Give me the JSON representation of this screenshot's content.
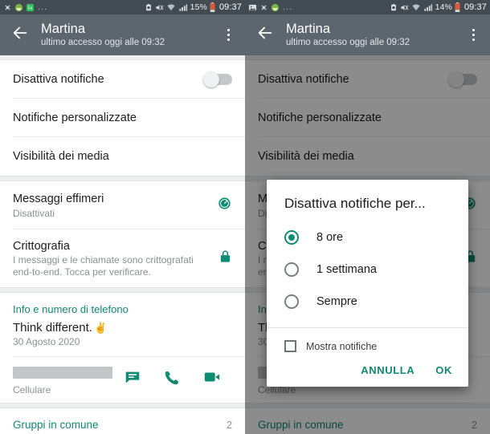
{
  "screens": [
    {
      "id": "left",
      "statusbar": {
        "left_icons": [
          "bluetooth-off-icon",
          "app-icon-green",
          "app-icon-5a"
        ],
        "overflow": "...",
        "right_icons": [
          "alarm-icon",
          "mute-icon",
          "wifi-icon",
          "signal-icon"
        ],
        "battery_percent": "15%",
        "battery_icon": "battery-icon",
        "time": "09:37"
      },
      "toolbar": {
        "back_icon": "back-arrow-icon",
        "title": "Martina",
        "subtitle": "ultimo accesso oggi alle 09:32",
        "menu_icon": "overflow-menu-icon"
      },
      "list": [
        {
          "title": "Disattiva notifiche",
          "control": "toggle-off"
        },
        {
          "title": "Notifiche personalizzate"
        },
        {
          "title": "Visibilità dei media"
        },
        {
          "title": "Messaggi effimeri",
          "subtitle": "Disattivati",
          "icon": "timer-icon"
        },
        {
          "title": "Crittografia",
          "subtitle": "I messaggi e le chiamate sono crittografati end-to-end. Tocca per verificare.",
          "icon": "lock-icon"
        }
      ],
      "info": {
        "section_label": "Info e numero di telefono",
        "bio": "Think different.",
        "bio_emoji": "✌️",
        "bio_date": "30 Agosto 2020",
        "number_label": "Cellulare",
        "number_value": "",
        "actions": [
          "message-icon",
          "call-icon",
          "video-call-icon"
        ]
      },
      "groups": {
        "label": "Gruppi in comune",
        "count": "2"
      },
      "dialog": null
    },
    {
      "id": "right",
      "statusbar": {
        "left_icons": [
          "image-icon",
          "bluetooth-off-icon",
          "app-icon-green"
        ],
        "overflow": "...",
        "right_icons": [
          "alarm-icon",
          "mute-icon",
          "wifi-icon",
          "signal-icon"
        ],
        "battery_percent": "14%",
        "battery_icon": "battery-icon",
        "time": "09:37"
      },
      "toolbar": {
        "back_icon": "back-arrow-icon",
        "title": "Martina",
        "subtitle": "ultimo accesso oggi alle 09:32",
        "menu_icon": "overflow-menu-icon"
      },
      "list": [
        {
          "title": "Disattiva notifiche",
          "control": "toggle-off"
        },
        {
          "title": "Notifiche personalizzate"
        },
        {
          "title": "Visibilità dei media"
        },
        {
          "title": "Messaggi effimeri",
          "subtitle": "Disattivati",
          "icon": "timer-icon"
        },
        {
          "title": "Crittografia",
          "subtitle": "I messaggi e le chiamate sono crittografati end-to-end. Tocca per verificare.",
          "icon": "lock-icon"
        }
      ],
      "info": {
        "section_label": "Info e numero di telefono",
        "bio": "Think different.",
        "bio_emoji": "✌️",
        "bio_date": "30 Agosto 2020",
        "number_label": "Cellulare",
        "number_value": "",
        "actions": [
          "message-icon",
          "call-icon",
          "video-call-icon"
        ]
      },
      "groups": {
        "label": "Gruppi in comune",
        "count": "2"
      },
      "dialog": {
        "title": "Disattiva notifiche per...",
        "options": [
          {
            "label": "8 ore",
            "selected": true
          },
          {
            "label": "1 settimana",
            "selected": false
          },
          {
            "label": "Sempre",
            "selected": false
          }
        ],
        "checkbox": {
          "label": "Mostra notifiche",
          "checked": false
        },
        "cancel_label": "ANNULLA",
        "ok_label": "OK"
      }
    }
  ],
  "colors": {
    "statusbar_bg": "#424b52",
    "toolbar_bg": "#5d666f",
    "accent_green": "#0f8b74",
    "divider": "#e8e9ea",
    "section_gap": "#eceef0",
    "scrim": "rgba(0,0,0,0.45)"
  }
}
